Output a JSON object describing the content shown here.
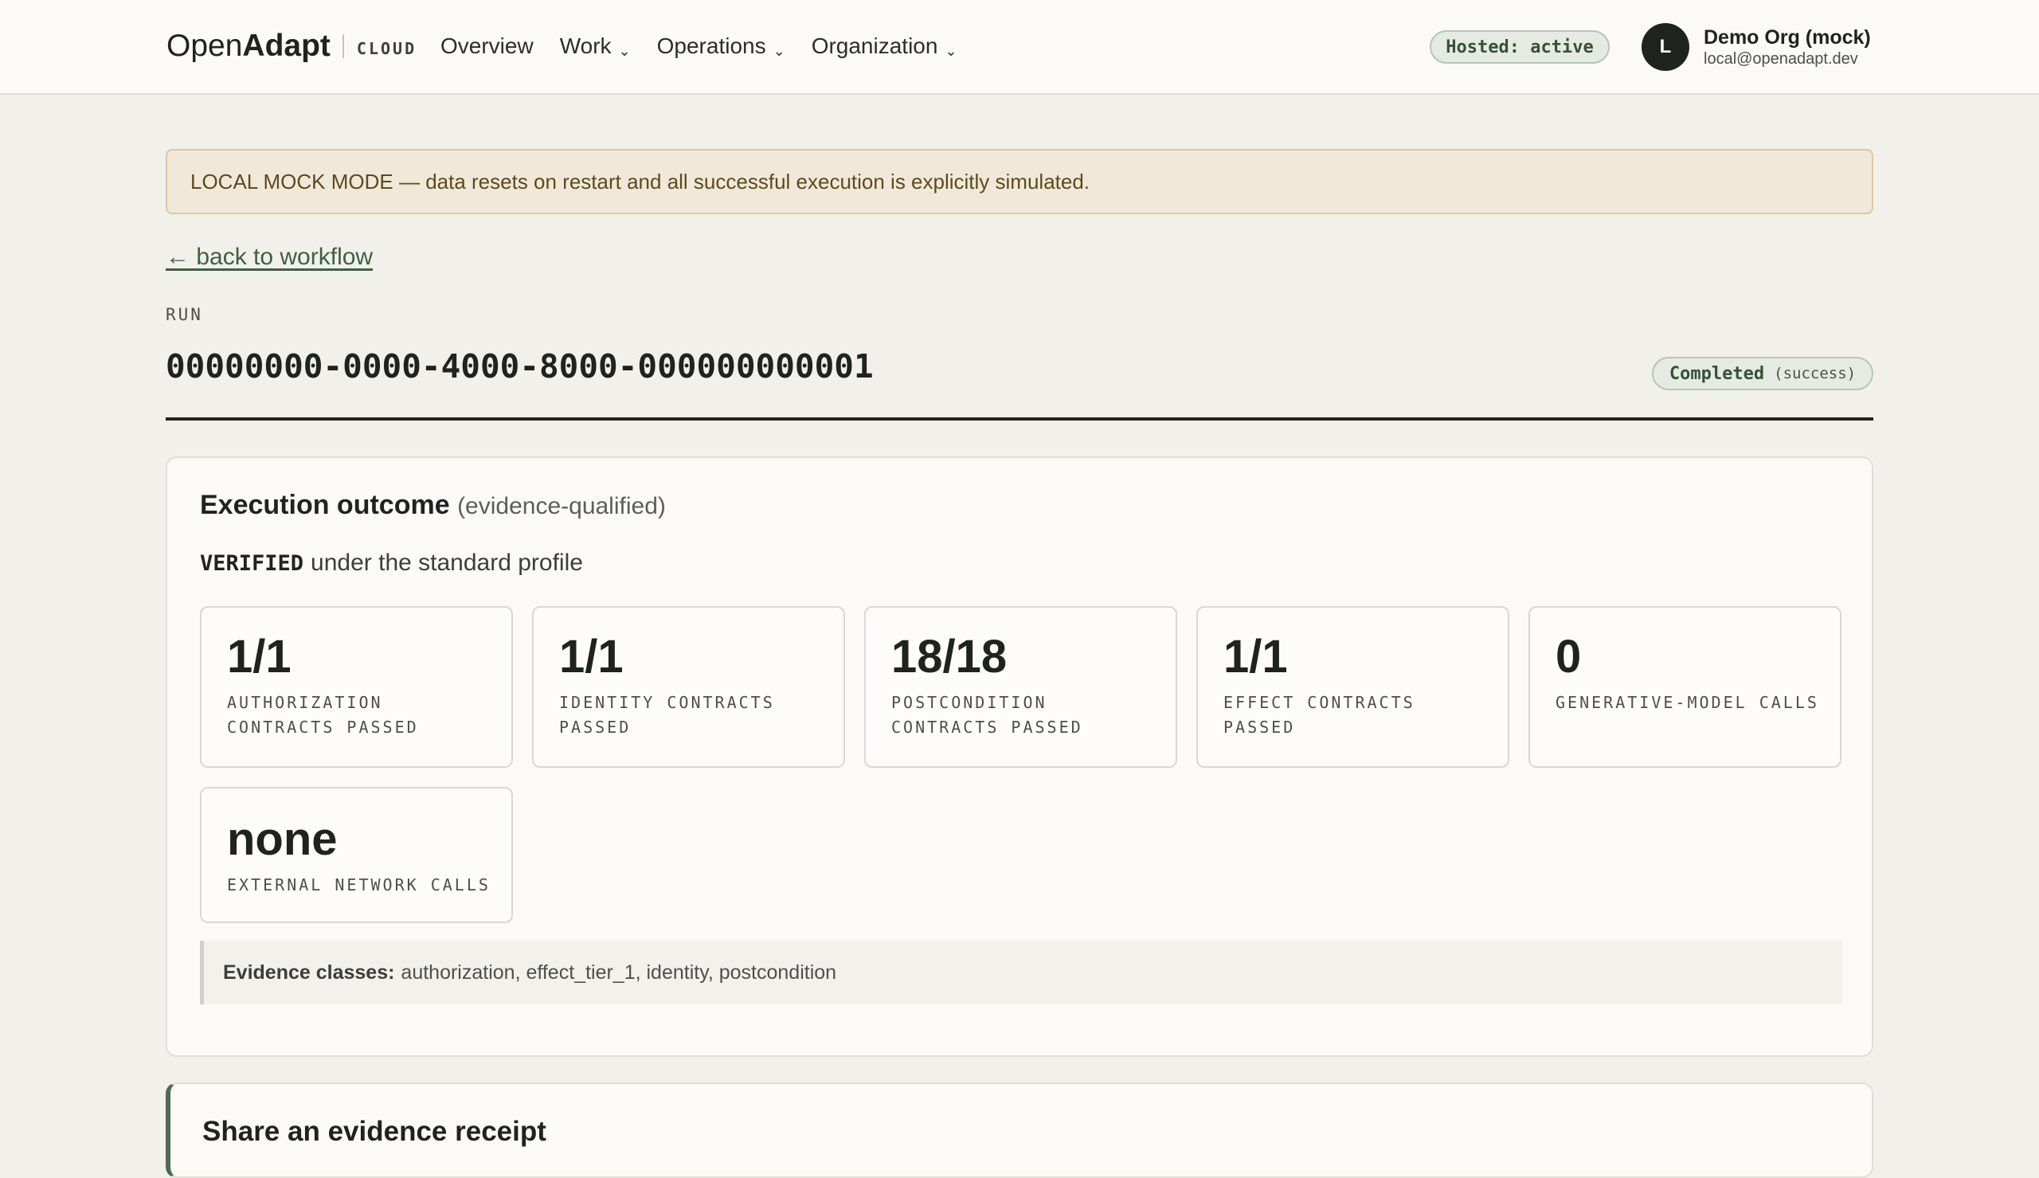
{
  "header": {
    "brand": {
      "open": "Open",
      "adapt": "Adapt",
      "tag": "CLOUD"
    },
    "nav": [
      {
        "label": "Overview",
        "dropdown": false
      },
      {
        "label": "Work",
        "dropdown": true
      },
      {
        "label": "Operations",
        "dropdown": true
      },
      {
        "label": "Organization",
        "dropdown": true
      }
    ],
    "dropdown_glyph": "⌄",
    "hosted_badge": "Hosted: active",
    "user": {
      "initial": "L",
      "name": "Demo Org (mock)",
      "email": "local@openadapt.dev"
    }
  },
  "banner": {
    "text": "LOCAL MOCK MODE — data resets on restart and all successful execution is explicitly simulated."
  },
  "back_link": "← back to workflow",
  "run": {
    "label": "RUN",
    "id": "00000000-0000-4000-8000-000000000001",
    "status": "Completed",
    "status_detail": "(success)"
  },
  "outcome": {
    "title": "Execution outcome",
    "title_qualifier": "(evidence-qualified)",
    "verified_word": "VERIFIED",
    "verified_suffix": "under the standard profile",
    "metrics": [
      {
        "value": "1/1",
        "label": "AUTHORIZATION CONTRACTS PASSED"
      },
      {
        "value": "1/1",
        "label": "IDENTITY CONTRACTS PASSED"
      },
      {
        "value": "18/18",
        "label": "POSTCONDITION CONTRACTS PASSED"
      },
      {
        "value": "1/1",
        "label": "EFFECT CONTRACTS PASSED"
      },
      {
        "value": "0",
        "label": "GENERATIVE-MODEL CALLS"
      },
      {
        "value": "none",
        "label": "EXTERNAL NETWORK CALLS"
      }
    ],
    "evidence_label": "Evidence classes:",
    "evidence_value": "authorization, effect_tier_1, identity, postcondition"
  },
  "share": {
    "title": "Share an evidence receipt"
  },
  "colors": {
    "background": "#f2f0ea",
    "accent_green": "#35513a",
    "banner_bg": "#f0e9d9",
    "banner_text": "#5d4a1c",
    "link": "#3f5e47"
  }
}
